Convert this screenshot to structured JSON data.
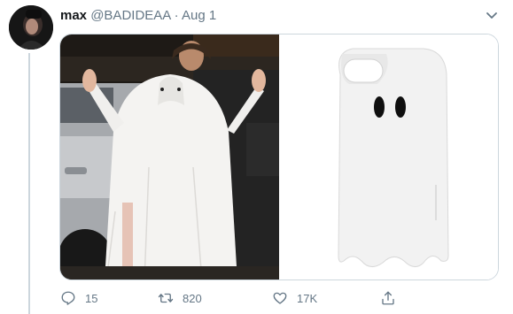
{
  "tweet": {
    "display_name": "max",
    "handle": "@BADIDEAA",
    "separator": "·",
    "date": "Aug 1"
  },
  "actions": {
    "reply_count": "15",
    "retweet_count": "820",
    "like_count": "17K"
  },
  "icons": [
    "avatar",
    "caret-down-icon",
    "reply-icon",
    "retweet-icon",
    "like-icon",
    "share-icon"
  ],
  "colors": {
    "secondary_text": "#657786",
    "border": "#ccd6dd"
  }
}
